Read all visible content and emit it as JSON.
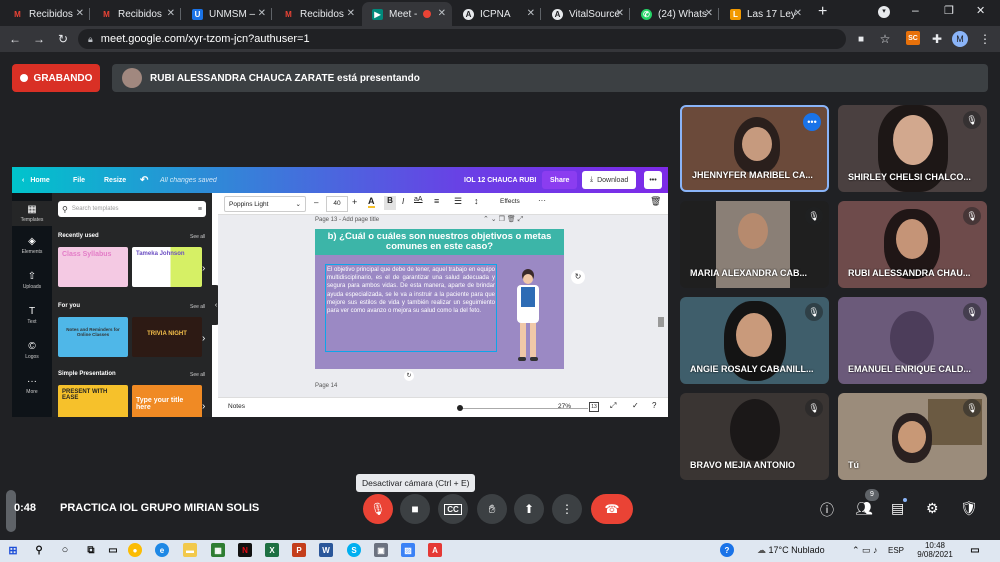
{
  "browser": {
    "tabs": [
      {
        "title": "Recibidos",
        "favicon": "gmail-icon",
        "color": "#ea4335"
      },
      {
        "title": "Recibidos",
        "favicon": "gmail-icon",
        "color": "#ea4335"
      },
      {
        "title": "UNMSM –",
        "favicon": "unmsm-icon",
        "color": "#1a73e8"
      },
      {
        "title": "Recibidos",
        "favicon": "gmail-icon",
        "color": "#ea4335"
      },
      {
        "title": "Meet -",
        "favicon": "meet-icon",
        "color": "#00897b"
      },
      {
        "title": "ICPNA",
        "favicon": "icpna-icon",
        "color": "#e8eaed"
      },
      {
        "title": "VitalSource",
        "favicon": "vitalsource-icon",
        "color": "#e8eaed"
      },
      {
        "title": "(24) Whats",
        "favicon": "whatsapp-icon",
        "color": "#25d366"
      },
      {
        "title": "Las 17 Ley",
        "favicon": "ley-icon",
        "color": "#f29900"
      }
    ],
    "url": "meet.google.com/xyr-tzom-jcn?authuser=1",
    "profile_initial": "M",
    "ext_label": "SC"
  },
  "meet": {
    "recording_label": "GRABANDO",
    "presenting_text": "RUBI ALESSANDRA CHAUCA ZARATE está presentando",
    "participants": [
      {
        "name": "JHENNYFER MARIBEL CA...",
        "bg": "#6b4a3a"
      },
      {
        "name": "SHIRLEY CHELSI CHALCO...",
        "bg": "#4a4040"
      },
      {
        "name": "MARIA ALEXANDRA CAB...",
        "bg": "#8a7f76"
      },
      {
        "name": "RUBI ALESSANDRA CHAU...",
        "bg": "#6e4b4b"
      },
      {
        "name": "ANGIE ROSALY CABANILL...",
        "bg": "#3f5e6b"
      },
      {
        "name": "EMANUEL ENRIQUE CALD...",
        "bg": "#6b5a7a"
      },
      {
        "name": "BRAVO MEJIA ANTONIO",
        "bg": "#3a3533"
      },
      {
        "name": "Tú",
        "bg": "#9b8c7b"
      }
    ],
    "tooltip": "Desactivar cámara (Ctrl + E)",
    "time": "0:48",
    "meeting_name": "PRACTICA IOL GRUPO MIRIAN SOLIS",
    "people_count": "9"
  },
  "canva": {
    "nav": {
      "home": "Home",
      "file": "File",
      "resize": "Resize",
      "saved": "All changes saved",
      "doc_title": "IOL 12 CHAUCA RUBI",
      "share": "Share",
      "download": "Download"
    },
    "tools": [
      "Templates",
      "Elements",
      "Uploads",
      "Text",
      "Logos",
      "More"
    ],
    "search_placeholder": "Search templates",
    "sections": {
      "recent": "Recently used",
      "for_you": "For you",
      "simple": "Simple Presentation",
      "see_all": "See all"
    },
    "thumbs": [
      "Class Syllabus",
      "Tameka Johnson",
      "Notes and Reminders for Online Classes",
      "TRIVIA NIGHT",
      "PRESENT WITH EASE",
      "Type your title here"
    ],
    "font": "Poppins Light",
    "font_size": "40",
    "effects": "Effects",
    "page13": "Page 13 - Add page title",
    "page14": "Page 14",
    "slide_title": "b) ¿Cuál o cuáles son nuestros objetivos o metas comunes en este caso?",
    "slide_body": "El objetivo principal que debe de tener, aquel trabajo en equipo multidisciplinario, es el de garantizar una salud adecuada y segura para ambos vidas. De esta manera, aparte de brindar ayuda especializada, se le va a instruir a la paciente para que mejore sus estilos de vida y también realizar un seguimiento para ver como avanzo o mejora su salud como la del feto.",
    "notes": "Notes",
    "zoom": "27%",
    "page_num": "13"
  },
  "taskbar": {
    "temp": "17°C",
    "weather": "Nublado",
    "lang": "ESP",
    "time": "10:48",
    "date": "9/08/2021"
  },
  "colors": {
    "accent_red": "#d93025",
    "canva_purple": "#7d2ae8",
    "meet_bg": "#202124"
  }
}
